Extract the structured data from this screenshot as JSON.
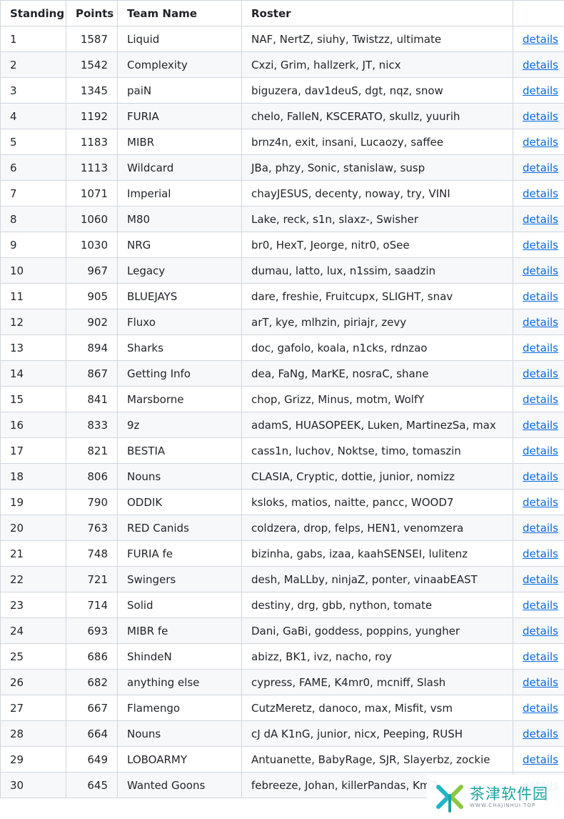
{
  "table": {
    "headers": {
      "standing": "Standing",
      "points": "Points",
      "team": "Team Name",
      "roster": "Roster",
      "details": ""
    },
    "link_label": "details",
    "rows": [
      {
        "standing": "1",
        "points": "1587",
        "team": "Liquid",
        "roster": "NAF, NertZ, siuhy, Twistzz, ultimate"
      },
      {
        "standing": "2",
        "points": "1542",
        "team": "Complexity",
        "roster": "Cxzi, Grim, hallzerk, JT, nicx"
      },
      {
        "standing": "3",
        "points": "1345",
        "team": "paiN",
        "roster": "biguzera, dav1deuS, dgt, nqz, snow"
      },
      {
        "standing": "4",
        "points": "1192",
        "team": "FURIA",
        "roster": "chelo, FalleN, KSCERATO, skullz, yuurih"
      },
      {
        "standing": "5",
        "points": "1183",
        "team": "MIBR",
        "roster": "brnz4n, exit, insani, Lucaozy, saffee"
      },
      {
        "standing": "6",
        "points": "1113",
        "team": "Wildcard",
        "roster": "JBa, phzy, Sonic, stanislaw, susp"
      },
      {
        "standing": "7",
        "points": "1071",
        "team": "Imperial",
        "roster": "chayJESUS, decenty, noway, try, VINI"
      },
      {
        "standing": "8",
        "points": "1060",
        "team": "M80",
        "roster": "Lake, reck, s1n, slaxz-, Swisher"
      },
      {
        "standing": "9",
        "points": "1030",
        "team": "NRG",
        "roster": "br0, HexT, Jeorge, nitr0, oSee"
      },
      {
        "standing": "10",
        "points": "967",
        "team": "Legacy",
        "roster": "dumau, latto, lux, n1ssim, saadzin"
      },
      {
        "standing": "11",
        "points": "905",
        "team": "BLUEJAYS",
        "roster": "dare, freshie, Fruitcupx, SLIGHT, snav"
      },
      {
        "standing": "12",
        "points": "902",
        "team": "Fluxo",
        "roster": "arT, kye, mlhzin, piriajr, zevy"
      },
      {
        "standing": "13",
        "points": "894",
        "team": "Sharks",
        "roster": "doc, gafolo, koala, n1cks, rdnzao"
      },
      {
        "standing": "14",
        "points": "867",
        "team": "Getting Info",
        "roster": "dea, FaNg, MarKE, nosraC, shane"
      },
      {
        "standing": "15",
        "points": "841",
        "team": "Marsborne",
        "roster": "chop, Grizz, Minus, motm, WolfY"
      },
      {
        "standing": "16",
        "points": "833",
        "team": "9z",
        "roster": "adamS, HUASOPEEK, Luken, MartinezSa, max"
      },
      {
        "standing": "17",
        "points": "821",
        "team": "BESTIA",
        "roster": "cass1n, luchov, Noktse, timo, tomaszin"
      },
      {
        "standing": "18",
        "points": "806",
        "team": "Nouns",
        "roster": "CLASIA, Cryptic, dottie, junior, nomizz"
      },
      {
        "standing": "19",
        "points": "790",
        "team": "ODDIK",
        "roster": "ksloks, matios, naitte, pancc, WOOD7"
      },
      {
        "standing": "20",
        "points": "763",
        "team": "RED Canids",
        "roster": "coldzera, drop, felps, HEN1, venomzera"
      },
      {
        "standing": "21",
        "points": "748",
        "team": "FURIA fe",
        "roster": "bizinha, gabs, izaa, kaahSENSEI, lulitenz"
      },
      {
        "standing": "22",
        "points": "721",
        "team": "Swingers",
        "roster": "desh, MaLLby, ninjaZ, ponter, vinaabEAST"
      },
      {
        "standing": "23",
        "points": "714",
        "team": "Solid",
        "roster": "destiny, drg, gbb, nython, tomate"
      },
      {
        "standing": "24",
        "points": "693",
        "team": "MIBR fe",
        "roster": "Dani, GaBi, goddess, poppins, yungher"
      },
      {
        "standing": "25",
        "points": "686",
        "team": "ShindeN",
        "roster": "abizz, BK1, ivz, nacho, roy"
      },
      {
        "standing": "26",
        "points": "682",
        "team": "anything else",
        "roster": "cypress, FAME, K4mr0, mcniff, Slash"
      },
      {
        "standing": "27",
        "points": "667",
        "team": "Flamengo",
        "roster": "CutzMeretz, danoco, max, Misfit, vsm"
      },
      {
        "standing": "28",
        "points": "664",
        "team": "Nouns",
        "roster": "cJ dA K1nG, junior, nicx, Peeping, RUSH"
      },
      {
        "standing": "29",
        "points": "649",
        "team": "LOBOARMY",
        "roster": "Antuanette, BabyRage, SJR, Slayerbz, zockie"
      },
      {
        "standing": "30",
        "points": "645",
        "team": "Wanted Goons",
        "roster": "febreeze, Johan, killerPandas, KmZ"
      }
    ]
  },
  "watermark": {
    "title": "茶津软件园",
    "subtitle": "WWW.CHAJINHUI.TOP"
  }
}
